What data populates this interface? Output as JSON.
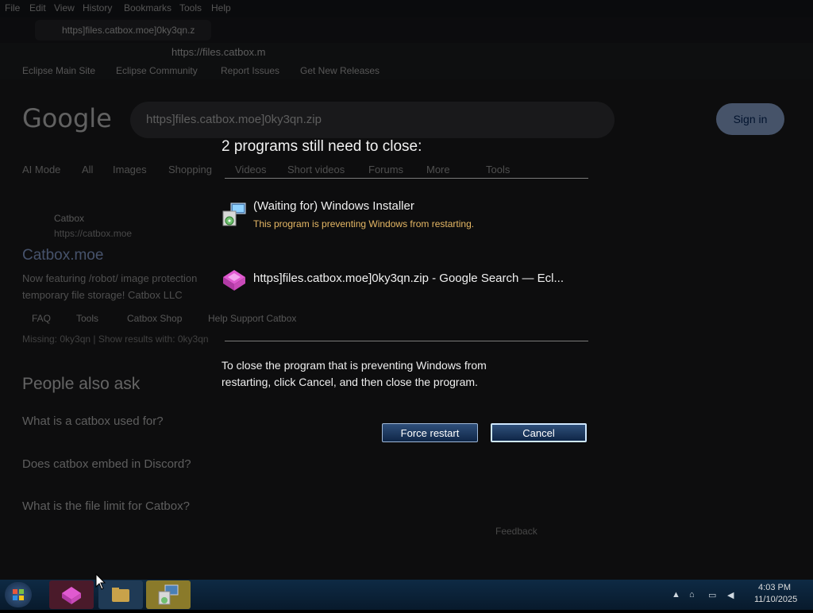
{
  "browser": {
    "menu": [
      "File",
      "Edit",
      "View",
      "History",
      "Bookmarks",
      "Tools",
      "Help"
    ],
    "tab_title": "https]files.catbox.moe]0ky3qn.z",
    "url": "https://files.catbox.m",
    "bookmarks": [
      "Eclipse Main Site",
      "Eclipse Community",
      "Report Issues",
      "Get New Releases"
    ]
  },
  "google": {
    "logo": "Google",
    "search_text": "https]files.catbox.moe]0ky3qn.zip",
    "sign_in": "Sign in",
    "tabs": [
      "AI Mode",
      "All",
      "Images",
      "Shopping",
      "Videos",
      "Short videos",
      "Forums",
      "More",
      "Tools"
    ],
    "result": {
      "site": "Catbox",
      "url": "https://catbox.moe",
      "title": "Catbox.moe",
      "snippet_1": "Now featuring /robot/ image protection",
      "snippet_2": "temporary file storage! Catbox LLC",
      "chips": [
        "FAQ",
        "Tools",
        "Catbox Shop",
        "Help Support Catbox"
      ],
      "missing": "Missing: 0ky3qn | Show results with: 0ky3qn"
    },
    "people_also_ask": "People also ask",
    "questions": [
      "What is a catbox used for?",
      "Does catbox embed in Discord?",
      "What is the file limit for Catbox?"
    ],
    "feedback": "Feedback"
  },
  "dialog": {
    "title": "2 programs still need to close:",
    "programs": [
      {
        "name": "(Waiting for) Windows Installer",
        "status": "This program is preventing Windows from restarting.",
        "icon": "installer-icon"
      },
      {
        "name": "https]files.catbox.moe]0ky3qn.zip - Google Search — Ecl...",
        "icon": "browser-icon"
      }
    ],
    "message_line1": "To close the program that is preventing Windows from",
    "message_line2": "restarting, click Cancel, and then close the program.",
    "force_restart": "Force restart",
    "cancel": "Cancel"
  },
  "taskbar": {
    "time": "4:03 PM",
    "date": "11/10/2025"
  },
  "colors": {
    "status_text": "#e6b865",
    "button_gradient_top": "#2f4f7a",
    "button_gradient_bottom": "#0f2647",
    "taskbar": "#0e2a44"
  }
}
